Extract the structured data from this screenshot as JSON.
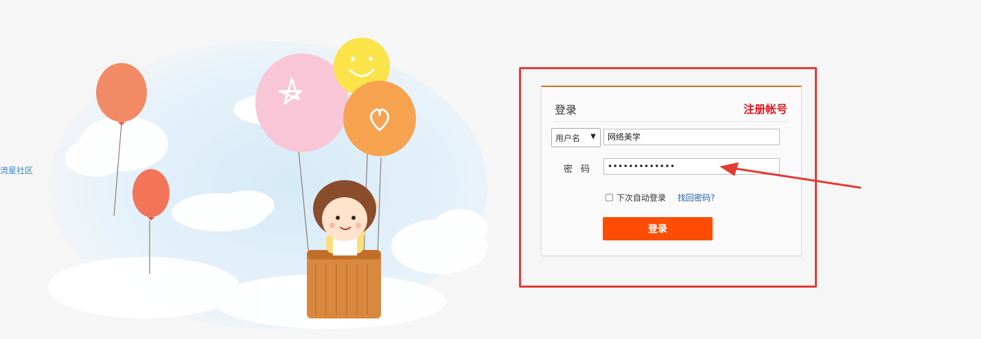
{
  "side_link": {
    "label": "流星社区"
  },
  "login": {
    "title": "登录",
    "register_label": "注册帐号",
    "account_type": {
      "selected": "用户名"
    },
    "username_value": "网络美学",
    "password_label": "密码",
    "password_masked": "•••••••••••••",
    "remember_label": "下次自动登录",
    "forgot_label": "找回密码?",
    "submit_label": "登录"
  },
  "colors": {
    "accent": "#fd4d05",
    "card_top_border": "#e06d1a",
    "register": "#e0191f",
    "annotation": "#e53935",
    "link": "#1d5fa8"
  },
  "icons": {
    "dropdown": "chevron-down-icon",
    "arrow": "annotation-arrow-icon"
  }
}
